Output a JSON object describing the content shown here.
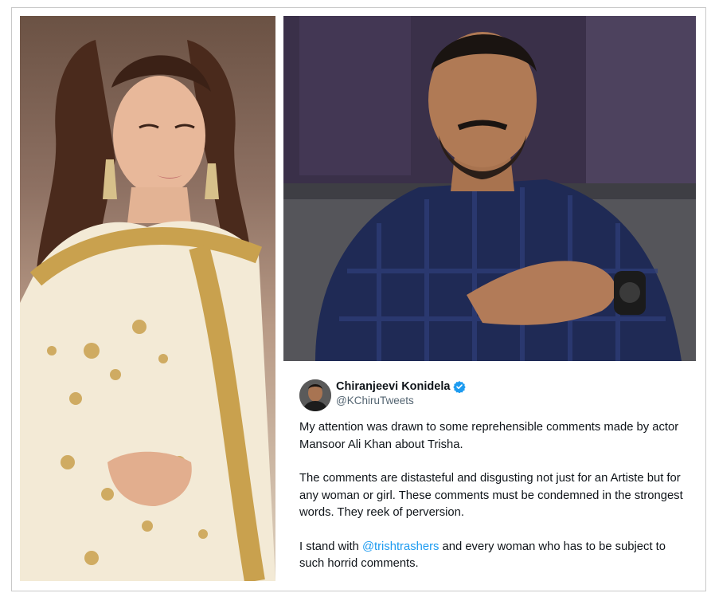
{
  "tweet": {
    "author_name": "Chiranjeevi Konidela",
    "author_handle": "@KChiruTweets",
    "paragraph_1": "My attention was drawn to some reprehensible comments made by actor Mansoor Ali Khan about Trisha.",
    "paragraph_2": "The comments are distasteful and disgusting not just for an Artiste but for any woman or girl. These comments must be condemned in the strongest words. They reek of perversion.",
    "paragraph_3_before": "I stand with ",
    "paragraph_3_mention": "@trishtrashers",
    "paragraph_3_after": " and every woman who has to be subject to such horrid comments."
  },
  "colors": {
    "verified_badge": "#1d9bf0",
    "mention": "#1d9bf0",
    "text": "#0f1419",
    "handle": "#536471"
  },
  "icons": {
    "verified": "verified-badge-icon"
  }
}
